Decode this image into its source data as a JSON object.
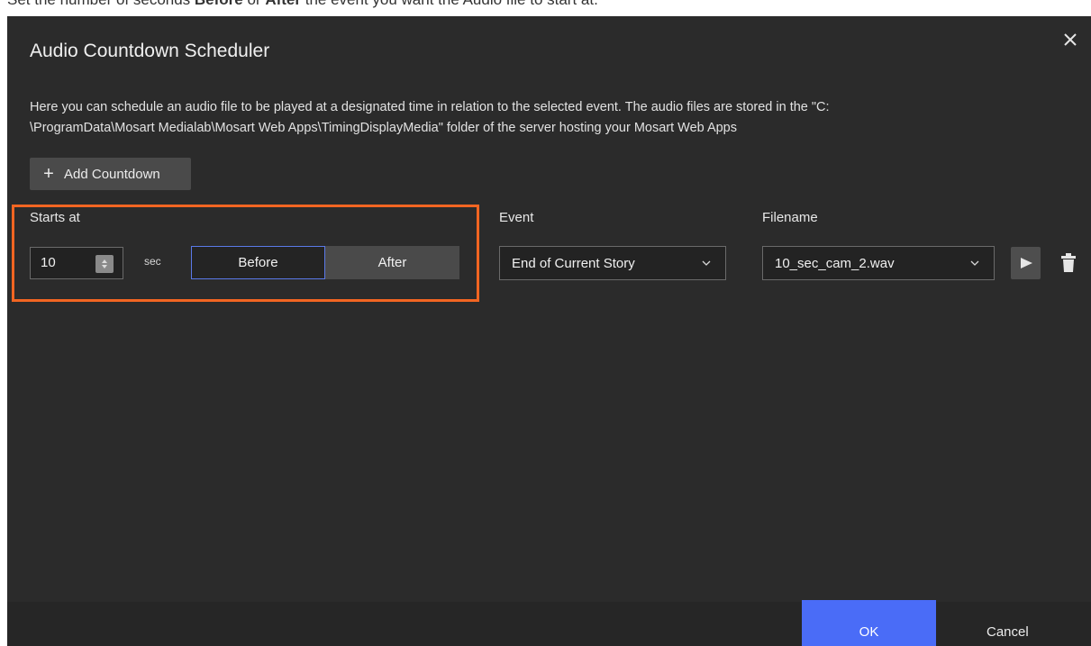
{
  "caption": {
    "part1": "Set the number of seconds ",
    "before_word": "Before",
    "part2": " or ",
    "after_word": "After",
    "part3": " the event you want the Audio file to start at."
  },
  "dialog": {
    "title": "Audio Countdown Scheduler",
    "close_icon": "close-icon",
    "description": "Here you can schedule an audio file to be played at a designated time in relation to the selected event. The audio files are stored in the \"C:\\ProgramData\\Mosart Medialab\\Mosart Web Apps\\TimingDisplayMedia\" folder of the server hosting your Mosart Web Apps",
    "description_line1": "Here you can schedule an audio file to be played at a designated time in relation to the selected event. The audio files are stored in the \"C:",
    "description_line2": "\\ProgramData\\Mosart Medialab\\Mosart Web Apps\\TimingDisplayMedia\" folder of the server hosting your Mosart Web Apps",
    "add_button_label": "Add Countdown",
    "add_icon": "plus-icon"
  },
  "countdown_row": {
    "starts_at_label": "Starts at",
    "seconds_value": "10",
    "unit": "sec",
    "before_label": "Before",
    "after_label": "After",
    "selected_toggle": "Before",
    "event_label": "Event",
    "event_value": "End of Current Story",
    "filename_label": "Filename",
    "filename_value": "10_sec_cam_2.wav",
    "play_icon": "play-icon",
    "delete_icon": "trash-icon"
  },
  "footer": {
    "ok_label": "OK",
    "cancel_label": "Cancel"
  },
  "colors": {
    "dialog_bg": "#2b2b2b",
    "highlight": "#f26522",
    "accent": "#4a6cf7",
    "selected_border": "#5a79e8"
  }
}
